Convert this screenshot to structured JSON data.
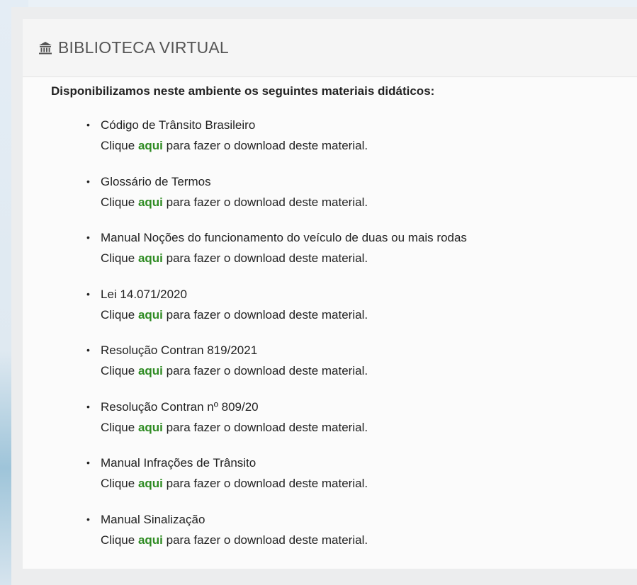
{
  "header": {
    "title": "BIBLIOTECA VIRTUAL",
    "icon": "bank-icon"
  },
  "intro": "Disponibilizamos neste ambiente os seguintes materiais didáticos:",
  "colors": {
    "link": "#2e8b22",
    "header_bg": "#f5f5f5",
    "text": "#222222"
  },
  "desc_prefix": "Clique",
  "link_label": "aqui",
  "desc_suffix": "para fazer o download deste material.",
  "items": [
    {
      "title": "Código de Trânsito Brasileiro"
    },
    {
      "title": "Glossário de Termos"
    },
    {
      "title": "Manual Noções do funcionamento do veículo de duas ou mais rodas"
    },
    {
      "title": "Lei 14.071/2020"
    },
    {
      "title": "Resolução Contran 819/2021"
    },
    {
      "title": "Resolução Contran nº 809/20"
    },
    {
      "title": "Manual Infrações de Trânsito"
    },
    {
      "title": "Manual Sinalização"
    }
  ]
}
